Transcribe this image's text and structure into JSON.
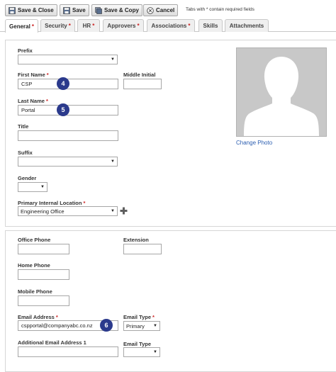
{
  "toolbar": {
    "save_close": "Save & Close",
    "save": "Save",
    "save_copy": "Save & Copy",
    "cancel": "Cancel",
    "required_note": "Tabs with * contain required fields"
  },
  "tabs": [
    {
      "label": "General",
      "required": "*"
    },
    {
      "label": "Security",
      "required": "*"
    },
    {
      "label": "HR",
      "required": "*"
    },
    {
      "label": "Approvers",
      "required": "*"
    },
    {
      "label": "Associations",
      "required": "*"
    },
    {
      "label": "Skills",
      "required": ""
    },
    {
      "label": "Attachments",
      "required": ""
    }
  ],
  "general": {
    "prefix_label": "Prefix",
    "prefix_value": "",
    "first_name_label": "First Name",
    "first_name_value": "CSP",
    "middle_initial_label": "Middle Initial",
    "middle_initial_value": "",
    "last_name_label": "Last Name",
    "last_name_value": "Portal",
    "title_label": "Title",
    "title_value": "",
    "suffix_label": "Suffix",
    "suffix_value": "",
    "gender_label": "Gender",
    "gender_value": "",
    "location_label": "Primary Internal Location",
    "location_value": "Engineering Office",
    "change_photo": "Change Photo",
    "required_mark": "*"
  },
  "contact": {
    "office_phone_label": "Office Phone",
    "extension_label": "Extension",
    "home_phone_label": "Home Phone",
    "mobile_phone_label": "Mobile Phone",
    "email_label": "Email Address",
    "email_value": "cspportal@companyabc.co.nz",
    "email_type_label": "Email Type",
    "email_type_value": "Primary",
    "additional_email_label": "Additional Email Address 1",
    "additional_email_value": "",
    "email_type2_label": "Email Type",
    "email_type2_value": ""
  },
  "badges": [
    "4",
    "5",
    "6"
  ],
  "colors": {
    "badge": "#2b3a8c",
    "required": "#cc2222",
    "link": "#2a5db0"
  },
  "icons": [
    "save-close-icon",
    "save-icon",
    "save-copy-icon",
    "cancel-icon",
    "add-location-icon",
    "chevron-down-icon",
    "person-silhouette-icon"
  ]
}
